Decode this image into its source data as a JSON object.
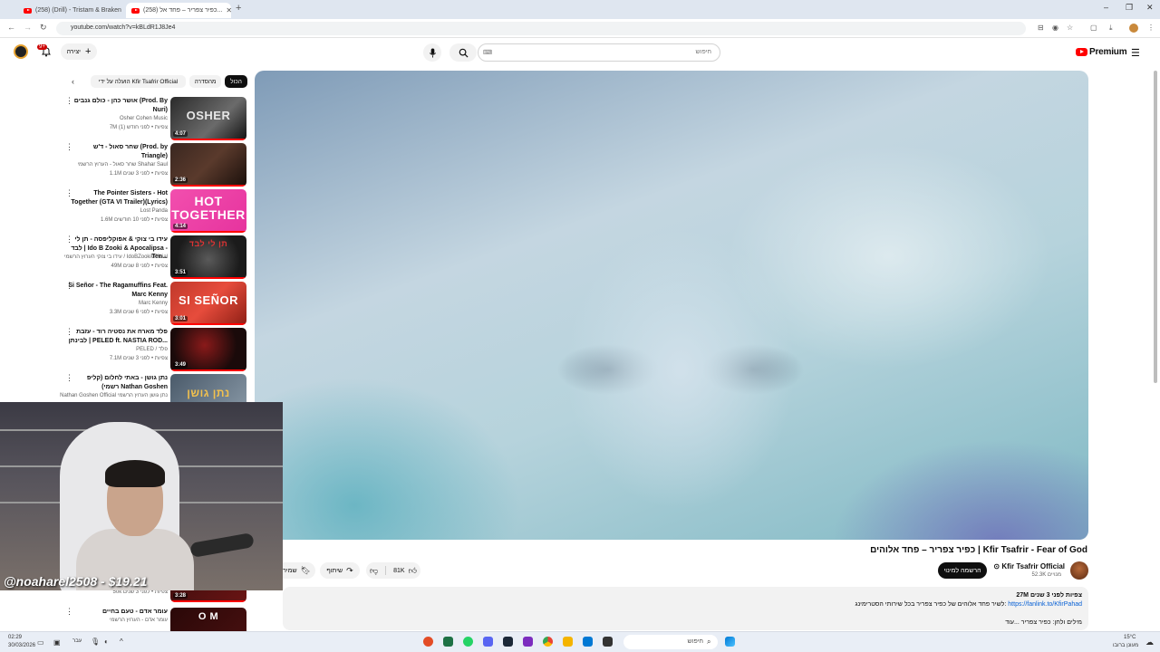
{
  "browser": {
    "tabs": [
      {
        "title": "(258) (Drill) - Tristam & Braken",
        "active": false
      },
      {
        "title": "(258) כפיר צפריר – פחד אל...",
        "active": true
      }
    ],
    "new_tab_label": "+",
    "url": "youtube.com/watch?v=kBLdR1J8Je4",
    "window_controls": {
      "minimize": "–",
      "maximize": "❐",
      "close": "✕"
    }
  },
  "header": {
    "logo_text": "Premium",
    "search_placeholder": "חיפוש",
    "create_label": "יצירה",
    "notification_count": "9+"
  },
  "chips": {
    "all": "הכול",
    "series": "מהסדרה",
    "uploaded_by": "הועלה על ידי Kfir Tsafrir Official"
  },
  "video": {
    "title": "כפיר צפריר – פחד אלוהים | Kfir Tsafrir - Fear of God",
    "channel": "Kfir Tsafrir Official",
    "subscribers": "52.3K מנויים",
    "subscribe_label": "הרשמה למינוי",
    "likes": "81K",
    "share_label": "שיתוף",
    "save_label": "שמירה",
    "stats": "27M צפיות  לפני 3 שנים",
    "desc_link": "https://fanlink.to/KfirPahad",
    "desc_text": "לשיר פחד אלוהים של כפיר צפריר בכל שירותי הסטרימינג:",
    "desc_line3": "מילים ולחן: כפיר צפריר ...עוד"
  },
  "related": [
    {
      "title": "אושר כהן - כולם גנבים (Prod. By Nuri)",
      "channel": "Osher Cohen Music",
      "meta": "7M צפיות • לפני חודש (1)",
      "duration": "4:07",
      "caption": "OSHER"
    },
    {
      "title": "שחר סאול - ד'ש (Prod. by Triangle)",
      "channel": "שחר סאול - הערוץ הרשמי Shahar Saul",
      "meta": "1.1M צפיות • לפני 3 שנים",
      "duration": "2:36",
      "caption": ""
    },
    {
      "title": "The Pointer Sisters - Hot Together (GTA VI Trailer)(Lyrics)",
      "channel": "Lost Panda",
      "meta": "1.6M צפיות • לפני 10 חודשים",
      "duration": "4:14",
      "caption": "HOT TOGETHER"
    },
    {
      "title": "עידו בי צוקי & אפוקליפסה - תן לי לבד | Ido B Zooki & Apocalipsa - Ten...",
      "channel": "עידו בי צוקי הערוץ הרשמי / IdoBZookiOfficial",
      "meta": "49M צפיות • לפני 8 שנים",
      "duration": "3:51",
      "caption": "תן לי לבד"
    },
    {
      "title": "Si Señor - The Ragamuffins Feat. Marc Kenny",
      "channel": "Marc Kenny",
      "meta": "3.3M צפיות • לפני 6 שנים",
      "duration": "3:01",
      "caption": "SI SEÑOR"
    },
    {
      "title": "פלד מארח את נסטיה רוד - עזבת לבינתן | PELED ft. NASTIA ROD...",
      "channel": "PELED / פלד",
      "meta": "7.1M צפיות • לפני 3 שנים",
      "duration": "3:49",
      "caption": ""
    },
    {
      "title": "נתן גושן - באתי לחלום (קליפ רשמי) Nathan Goshen",
      "channel": "Nathan Goshen Official נתן גושן הערוץ הרשמי",
      "meta": "",
      "duration": "",
      "caption": "נתן גושן"
    }
  ],
  "related_partial": {
    "meta": "50k צפיות • לפני 3 שנים",
    "duration": "3:28",
    "next_title": "עומר אדם - טעם בחיים",
    "next_channel": "עומר אדם - הערוץ הרשמי",
    "next_caption": "O  M"
  },
  "webcam": {
    "overlay_text": "@noaharel2508 - $19.21"
  },
  "taskbar": {
    "search_placeholder": "חיפוש",
    "clock_time": "02:29",
    "clock_date": "30/03/2026",
    "weather_temp": "15°C",
    "weather_desc": "מעונן ברובו",
    "lang": "עבר"
  },
  "colors": {
    "youtube_red": "#ff0000",
    "subscribe_black": "#0f0f0f",
    "link_blue": "#065fd4"
  }
}
